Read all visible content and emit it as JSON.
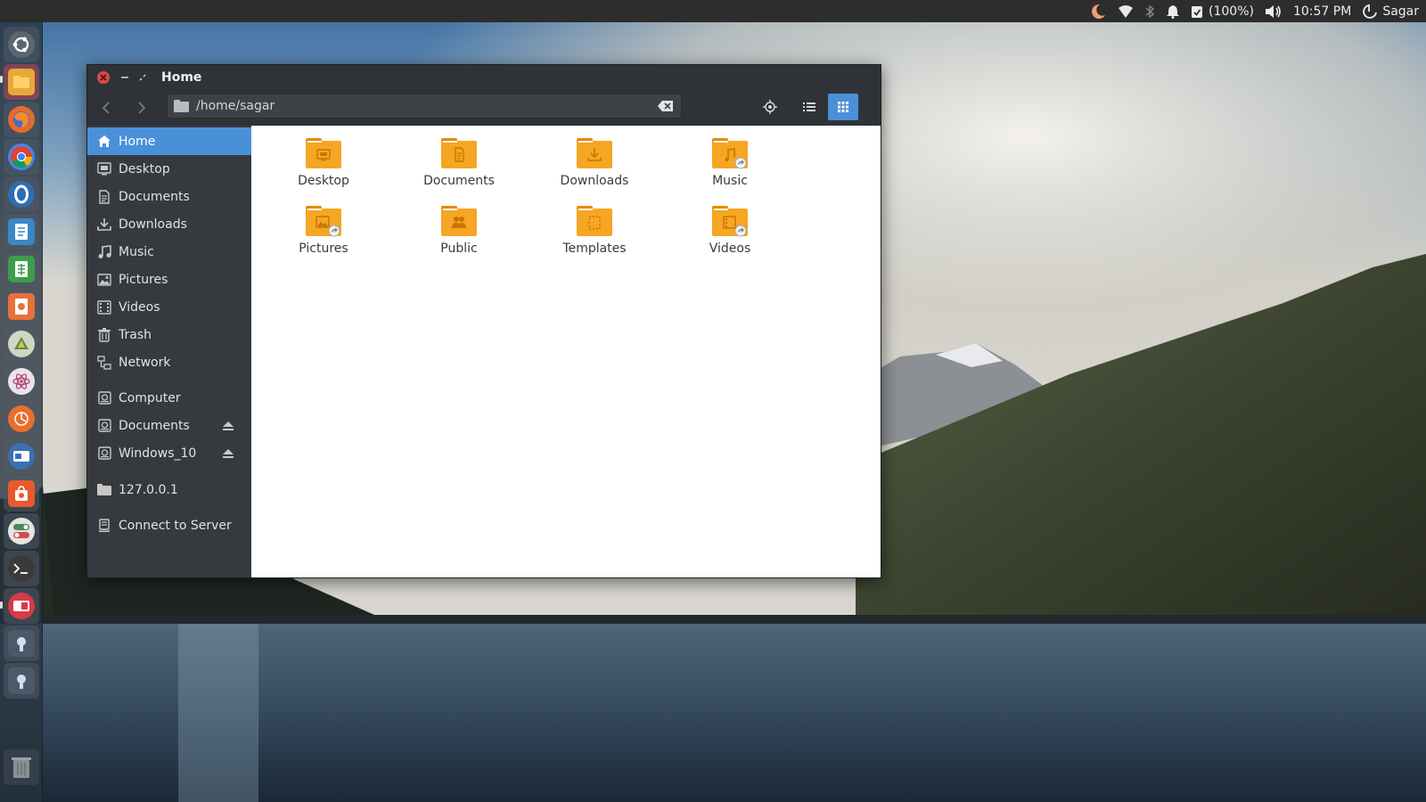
{
  "top_panel": {
    "battery_text": "(100%)",
    "clock": "10:57 PM",
    "user": "Sagar",
    "icons": [
      "night-light-icon",
      "wifi-icon",
      "bluetooth-icon",
      "notification-bell-icon",
      "clipboard-check-icon",
      "volume-icon",
      "power-icon"
    ]
  },
  "launcher": {
    "items": [
      {
        "name": "ubuntu-dash",
        "color": "#5b6670"
      },
      {
        "name": "files",
        "color": "#e8a93a"
      },
      {
        "name": "firefox",
        "color": "#e66a2c"
      },
      {
        "name": "chrome",
        "color": "#4285f4"
      },
      {
        "name": "opera",
        "color": "#2e6db0"
      },
      {
        "name": "libreoffice-writer",
        "color": "#3a87c8"
      },
      {
        "name": "libreoffice-calc",
        "color": "#3c9d4c"
      },
      {
        "name": "libreoffice-impress",
        "color": "#e8703a"
      },
      {
        "name": "inkscape",
        "color": "#5a8a4a"
      },
      {
        "name": "atom",
        "color": "#b04a7a"
      },
      {
        "name": "software-center",
        "color": "#e8702c"
      },
      {
        "name": "app-remote",
        "color": "#3a70b0"
      },
      {
        "name": "ubuntu-software",
        "color": "#e85a2c"
      },
      {
        "name": "settings-toggle",
        "color": "#4a8a5a"
      },
      {
        "name": "terminal",
        "color": "#3a3a3a"
      },
      {
        "name": "app-red",
        "color": "#d93a4a"
      },
      {
        "name": "scanner-1",
        "color": "#4a5a6a"
      },
      {
        "name": "scanner-2",
        "color": "#4a5a6a"
      },
      {
        "name": "trash",
        "color": "#6a6f74"
      }
    ]
  },
  "window": {
    "title": "Home",
    "path": "/home/sagar",
    "toolbar": {
      "back_icon": "chevron-left-icon",
      "forward_icon": "chevron-right-icon",
      "location_icon": "target-icon",
      "list_view_icon": "list-view-icon",
      "grid_view_icon": "grid-view-icon"
    },
    "sidebar": {
      "places": [
        {
          "label": "Home",
          "icon": "home-icon",
          "active": true
        },
        {
          "label": "Desktop",
          "icon": "desktop-icon"
        },
        {
          "label": "Documents",
          "icon": "document-icon"
        },
        {
          "label": "Downloads",
          "icon": "download-icon"
        },
        {
          "label": "Music",
          "icon": "music-icon"
        },
        {
          "label": "Pictures",
          "icon": "picture-icon"
        },
        {
          "label": "Videos",
          "icon": "video-icon"
        },
        {
          "label": "Trash",
          "icon": "trash-icon"
        },
        {
          "label": "Network",
          "icon": "network-icon"
        }
      ],
      "devices": [
        {
          "label": "Computer",
          "icon": "drive-icon"
        },
        {
          "label": "Documents",
          "icon": "drive-icon",
          "eject": true
        },
        {
          "label": "Windows_10",
          "icon": "drive-icon",
          "eject": true
        }
      ],
      "network": [
        {
          "label": "127.0.0.1",
          "icon": "folder-icon"
        }
      ],
      "connect": {
        "label": "Connect to Server",
        "icon": "server-icon"
      }
    },
    "files": [
      {
        "label": "Desktop",
        "emblem": "desktop"
      },
      {
        "label": "Documents",
        "emblem": "document"
      },
      {
        "label": "Downloads",
        "emblem": "download"
      },
      {
        "label": "Music",
        "emblem": "music",
        "link": true
      },
      {
        "label": "Pictures",
        "emblem": "picture",
        "link": true
      },
      {
        "label": "Public",
        "emblem": "public"
      },
      {
        "label": "Templates",
        "emblem": "template"
      },
      {
        "label": "Videos",
        "emblem": "video",
        "link": true
      }
    ],
    "colors": {
      "accent": "#4a90d9",
      "folder": "#f5a623",
      "folder_dark": "#e58a12",
      "sidebar_bg": "#363a3e",
      "titlebar_bg": "#2f3337"
    }
  }
}
